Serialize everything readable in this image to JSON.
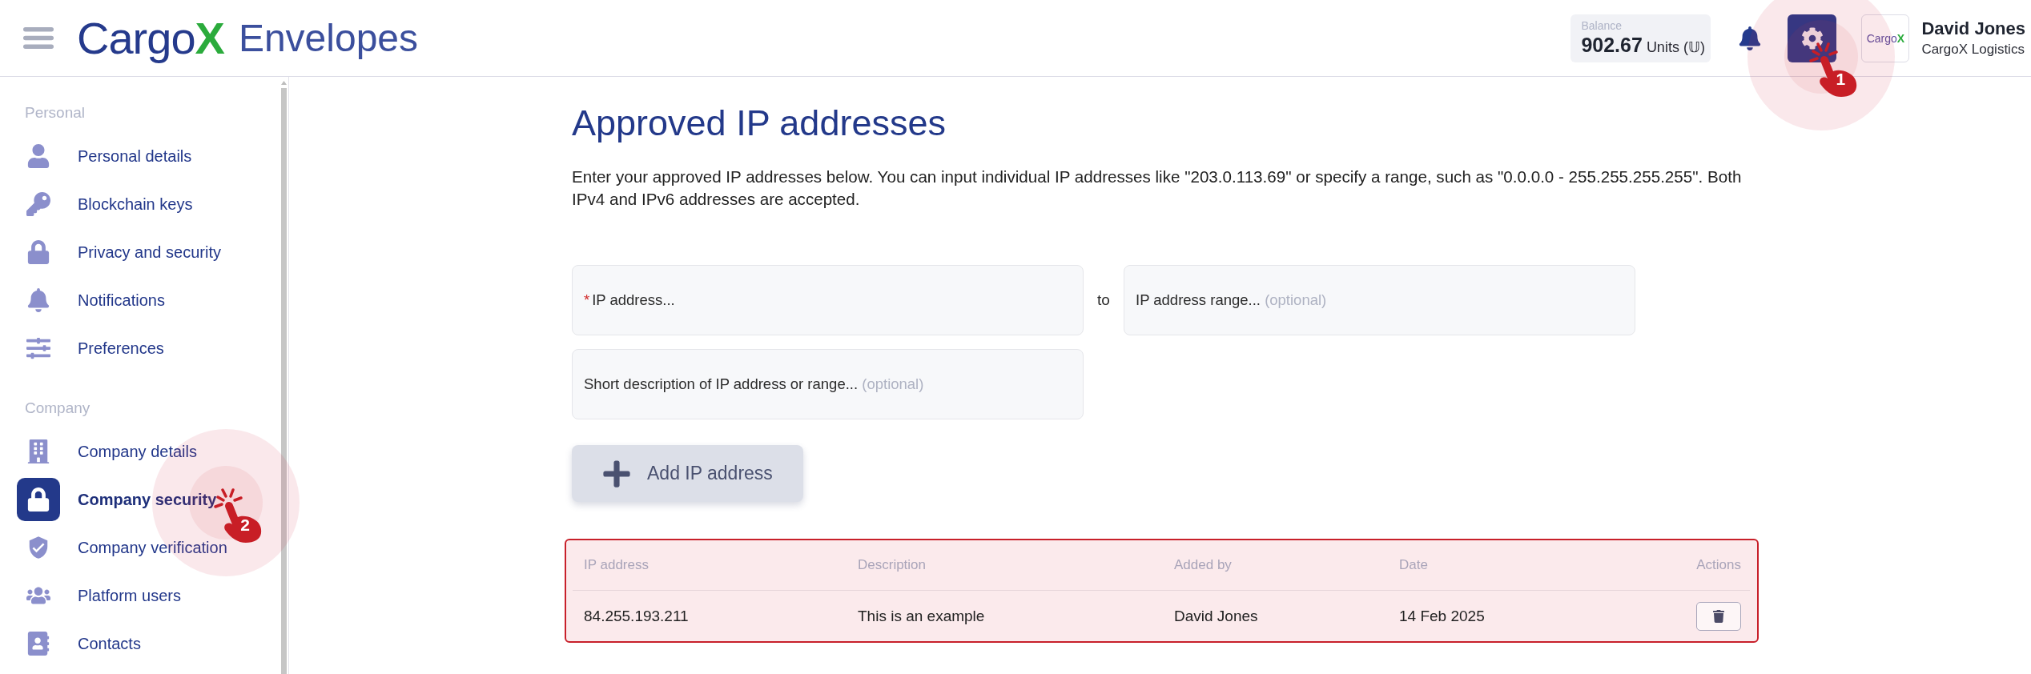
{
  "header": {
    "logo": {
      "wordmark": "Cargo",
      "mark": "X",
      "product": "Envelopes"
    },
    "balance": {
      "label": "Balance",
      "amount": "902.67",
      "unit": "Units (𝕌)"
    },
    "settings_button": {
      "click_marker": "1"
    },
    "user": {
      "logo": {
        "wordmark": "Cargo",
        "mark": "X"
      },
      "name": "David Jones",
      "company": "CargoX Logistics"
    }
  },
  "sidebar": {
    "sections": [
      {
        "title": "Personal",
        "items": [
          {
            "label": "Personal details",
            "selected": false
          },
          {
            "label": "Blockchain keys",
            "selected": false
          },
          {
            "label": "Privacy and security",
            "selected": false
          },
          {
            "label": "Notifications",
            "selected": false
          },
          {
            "label": "Preferences",
            "selected": false
          }
        ]
      },
      {
        "title": "Company",
        "items": [
          {
            "label": "Company details",
            "selected": false
          },
          {
            "label": "Company security",
            "selected": true,
            "click_marker": "2"
          },
          {
            "label": "Company verification",
            "selected": false
          },
          {
            "label": "Platform users",
            "selected": false
          },
          {
            "label": "Contacts",
            "selected": false
          }
        ]
      }
    ]
  },
  "page": {
    "title": "Approved IP addresses",
    "description": "Enter your approved IP addresses below. You can input individual IP addresses like \"203.0.113.69\" or specify a range, such as \"0.0.0.0 - 255.255.255.255\". Both IPv4 and IPv6 addresses are accepted.",
    "fields": [
      {
        "placeholder": "IP address...",
        "required_mark": "*"
      },
      {
        "placeholder": "IP address range...",
        "optional_note": "(optional)"
      },
      {
        "placeholder": "Short description of IP address or range...",
        "optional_note": "(optional)"
      }
    ],
    "range_separator": "to",
    "add_button": {
      "label": "Add IP address"
    },
    "table": {
      "highlighted": true,
      "columns": [
        "IP address",
        "Description",
        "Added by",
        "Date",
        "Actions"
      ],
      "rows": [
        {
          "cells": [
            "84.255.193.211",
            "This is an example",
            "David Jones",
            "14 Feb 2025"
          ]
        }
      ]
    }
  }
}
